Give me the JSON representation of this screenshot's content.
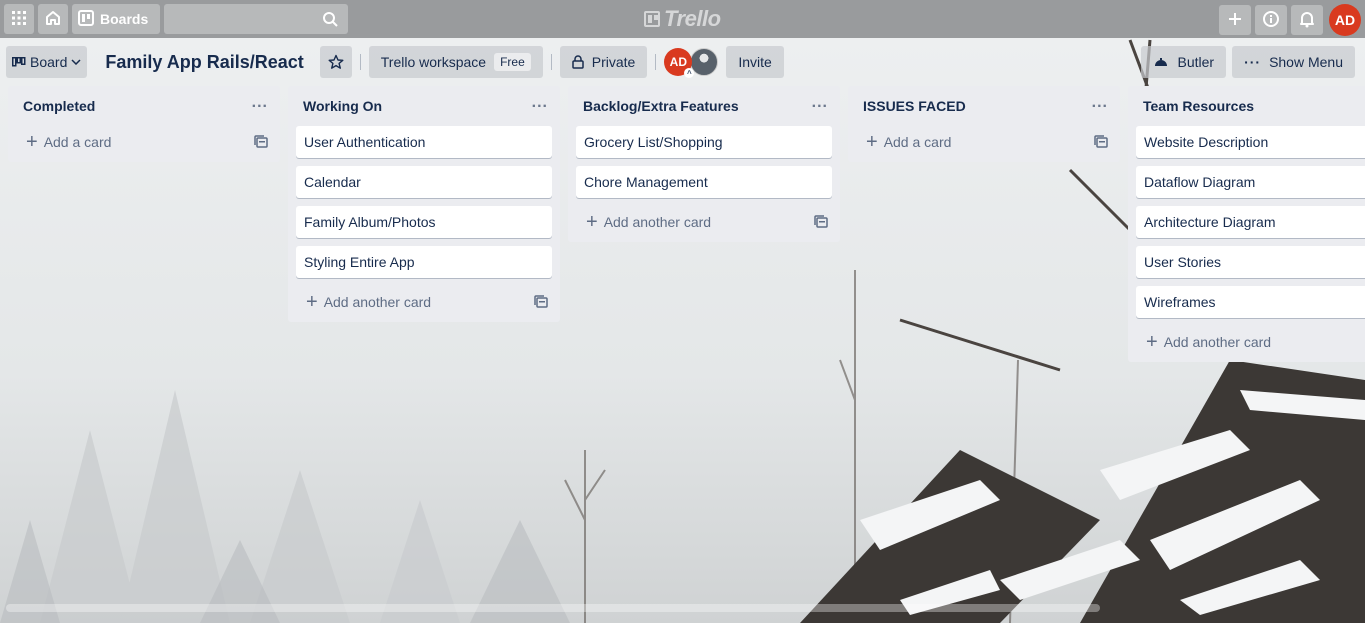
{
  "topnav": {
    "boards_label": "Boards",
    "logo_text": "Trello",
    "user_initials": "AD",
    "icons": [
      "apps-grid-icon",
      "home-icon",
      "boards-icon",
      "search-icon",
      "plus-icon",
      "info-icon",
      "bell-icon"
    ]
  },
  "header": {
    "view_label": "Board",
    "board_title": "Family App Rails/React",
    "workspace_label": "Trello workspace",
    "workspace_badge": "Free",
    "visibility_label": "Private",
    "member_initials": "AD",
    "invite_label": "Invite",
    "butler_label": "Butler",
    "show_menu_label": "Show Menu"
  },
  "lists": [
    {
      "title": "Completed",
      "cards": [],
      "composer": "Add a card"
    },
    {
      "title": "Working On",
      "cards": [
        "User Authentication",
        "Calendar",
        "Family Album/Photos",
        "Styling Entire App"
      ],
      "composer": "Add another card"
    },
    {
      "title": "Backlog/Extra Features",
      "cards": [
        "Grocery List/Shopping",
        "Chore Management"
      ],
      "composer": "Add another card"
    },
    {
      "title": "ISSUES FACED",
      "cards": [],
      "composer": "Add a card"
    },
    {
      "title": "Team Resources",
      "cards": [
        "Website Description",
        "Dataflow Diagram",
        "Architecture Diagram",
        "User Stories",
        "Wireframes"
      ],
      "composer": "Add another card"
    }
  ],
  "colors": {
    "nav_bg": "#999b9d",
    "avatar_red": "#d93a1f",
    "list_bg": "#ebecf0",
    "text": "#172b4d"
  }
}
